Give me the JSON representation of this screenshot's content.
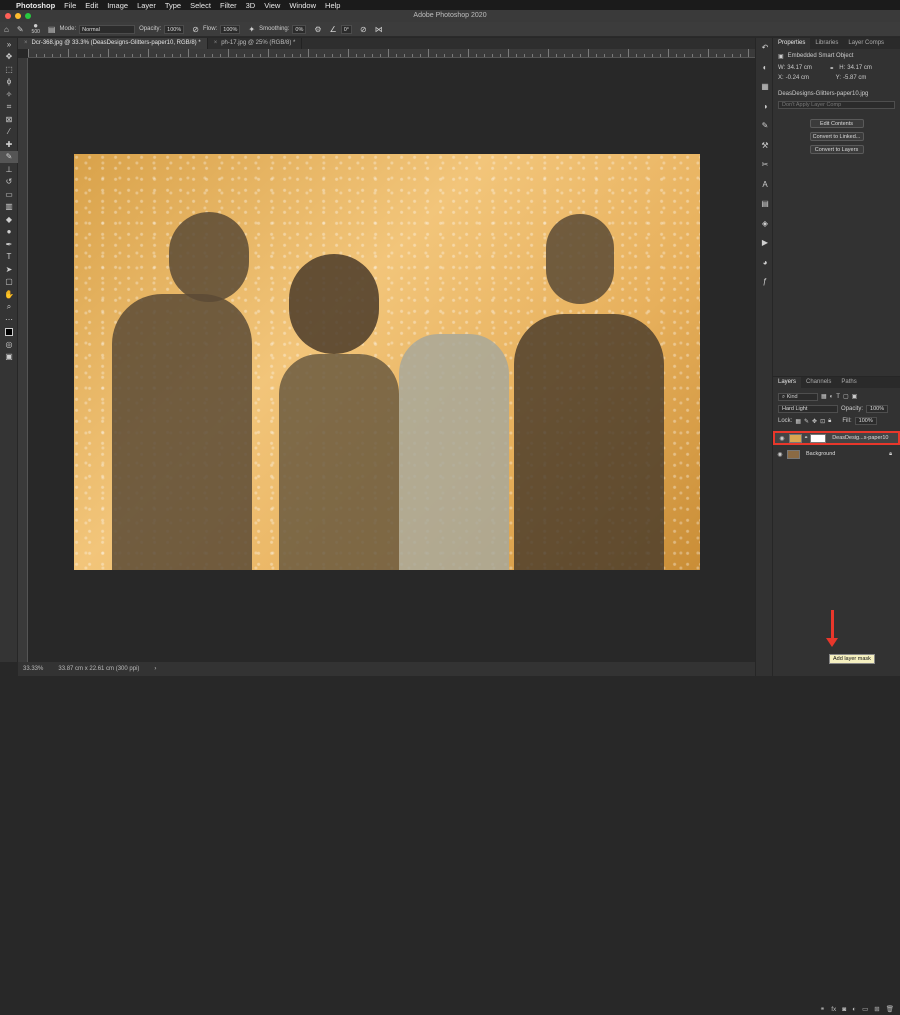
{
  "menubar": {
    "app": "Photoshop",
    "items": [
      "File",
      "Edit",
      "Image",
      "Layer",
      "Type",
      "Select",
      "Filter",
      "3D",
      "View",
      "Window",
      "Help"
    ]
  },
  "window": {
    "title": "Adobe Photoshop 2020"
  },
  "options": {
    "brush_size": "500",
    "mode_label": "Mode:",
    "mode_value": "Normal",
    "opacity_label": "Opacity:",
    "opacity_value": "100%",
    "flow_label": "Flow:",
    "flow_value": "100%",
    "smoothing_label": "Smoothing:",
    "smoothing_value": "0%",
    "angle_value": "0°"
  },
  "tabs": [
    {
      "label": "Dcr-368.jpg @ 33.3% (DeasDesigns-Glitters-paper10, RGB/8) *"
    },
    {
      "label": "ph-17.jpg @ 25% (RGB/8) *"
    }
  ],
  "status": {
    "zoom": "33.33%",
    "doc_size": "33.87 cm x 22.61 cm (300 ppi)"
  },
  "properties": {
    "tabs": [
      "Properties",
      "Libraries",
      "Layer Comps"
    ],
    "object_type": "Embedded Smart Object",
    "w_label": "W:",
    "w_value": "34.17 cm",
    "h_label": "H:",
    "h_value": "34.17 cm",
    "x_label": "X:",
    "x_value": "-0.24 cm",
    "y_label": "Y:",
    "y_value": "-5.87 cm",
    "filename": "DeasDesigns-Glitters-paper10.jpg",
    "layer_comp_placeholder": "Don't Apply Layer Comp",
    "btn_edit": "Edit Contents",
    "btn_linked": "Convert to Linked...",
    "btn_layers": "Convert to Layers"
  },
  "layers": {
    "tabs": [
      "Layers",
      "Channels",
      "Paths"
    ],
    "filter_kind": "Kind",
    "blend_mode": "Hard Light",
    "opacity_label": "Opacity:",
    "opacity_value": "100%",
    "lock_label": "Lock:",
    "fill_label": "Fill:",
    "fill_value": "100%",
    "items": [
      {
        "name": "DeasDesig...s-paper10",
        "selected": true
      },
      {
        "name": "Background",
        "selected": false
      }
    ],
    "tooltip": "Add layer mask"
  },
  "colors": {
    "highlight": "#e8372b",
    "panel": "#323232"
  }
}
